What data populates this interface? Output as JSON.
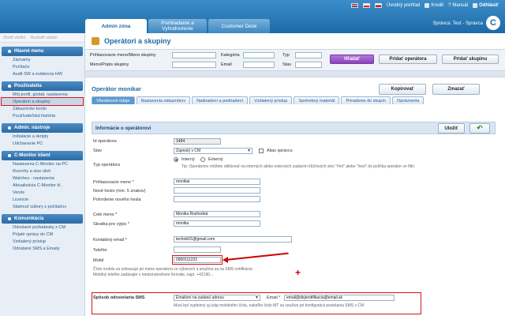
{
  "toplinks": {
    "overview": "Úvodný prehľad",
    "credit": "Kredit",
    "manual": "Manuál",
    "logout": "Odhlásiť"
  },
  "tabs": [
    {
      "label": "Admin zóna"
    },
    {
      "label": "Prehliadanie a Vyhodnotenie"
    },
    {
      "label": "Customer Desk"
    }
  ],
  "user_info": "Správca: Test - Spravca",
  "logo": "C",
  "sidebar": {
    "tools": [
      "Zbaliť všetko",
      "Rozbaliť všetko"
    ],
    "sections": [
      {
        "title": "Hlavné menu",
        "items": [
          "Záznamy",
          "Počítače",
          "Audit SW a evidencia HW"
        ]
      },
      {
        "title": "Používatelia",
        "items": [
          "Môj profil, globál. nastavenia",
          "Operátori a skupiny",
          "Zákaznícke konto",
          "Používateľská história"
        ]
      },
      {
        "title": "Admin. nástroje",
        "items": [
          "Inštalácie a skripty",
          "Udržiavanie PC"
        ]
      },
      {
        "title": "C-Monitor klient",
        "items": [
          "Nastavenia C-Monitor na PC",
          "Rozvrhy a stav úloh",
          "Watches - nastavenia",
          "Aktualizácia C-Monitor kl.",
          "Verzie",
          "Licencie",
          "Stiahnuť súbory z počítačov"
        ]
      },
      {
        "title": "Komunikácia",
        "items": [
          "Odoslané požiadavky z CM",
          "Prijaté správy do CM",
          "Vzdialený prístup",
          "Odoslané SMS a Emaily"
        ]
      }
    ]
  },
  "page_title": "Operátori a skupiny",
  "filter": {
    "login_label": "Prihlasovacie meno/Meno skupiny",
    "name_label": "Meno/Popis skupiny",
    "category_label": "Kategória",
    "email_label": "Email",
    "type_label": "Typ",
    "state_label": "Stav",
    "search_btn": "Hľadať",
    "add_operator_btn": "Pridať operátora",
    "add_group_btn": "Pridať skupinu"
  },
  "operator": {
    "header": "Operátor monikar",
    "copy_btn": "Kopírovať",
    "delete_btn": "Zmazať",
    "tabs": [
      "Všeobecné údaje",
      "Nastavenia zákazníkov",
      "Nadriadení a podriadení",
      "Vzdialený prístup",
      "Spotrebný materiál",
      "Priradenie do skupín",
      "Oprávnenia"
    ],
    "info_title": "Informácie o operátorovi",
    "save_btn": "Uložiť"
  },
  "form": {
    "id_label": "Id operátora",
    "id_value": "1494",
    "state_label": "Stav",
    "state_value": "Zapnutý v CM",
    "alias_label": "Alias správcu",
    "type_label": "Typ operátora",
    "type_internal": "Interný",
    "type_external": "Externý",
    "type_hint": "Tip: Operátorov môžete odlišovať na interných alebo externých zadaním kľúčových slov \"#int\" alebo \"#ext\" do políčka operátor vo filtri",
    "login_label": "Prihlasovacie meno *",
    "login_value": "monikar",
    "newpass_label": "Nové heslo (min. 5 znakov)",
    "confirmpass_label": "Potvrdenie nového hesla",
    "fullname_label": "Celé meno *",
    "fullname_value": "Monika Rozhodná",
    "short_label": "Skratka pre výpis *",
    "short_value": "monika",
    "email_label": "Kontaktný email *",
    "email_value": "technik01@gmail.com",
    "phone_label": "Telefón",
    "mobile_label": "Mobil",
    "mobile_value": "0900111222",
    "mobile_hint1": "Číslo mobilu sa zobrazuje pri mene operátora vo výberoch a používa sa na SMS notifikácie.",
    "mobile_hint2": "Mobilný telefón zadávajte v medzinárodnom formáte, napr. +42190...",
    "sms_label": "Spôsob odosielania SMS",
    "sms_value": "Emailom na zadanú adresu",
    "sms_email_label": "Email *",
    "sms_email_value": "email@dejerotifikacia@email.sk",
    "sms_hint": "Musí byť vyplnený aj údaj mobilného čísla, nakoľko číslo MT sa využíva pri konfigurácii posielania SMS v CM"
  },
  "plus_glyph": "+"
}
